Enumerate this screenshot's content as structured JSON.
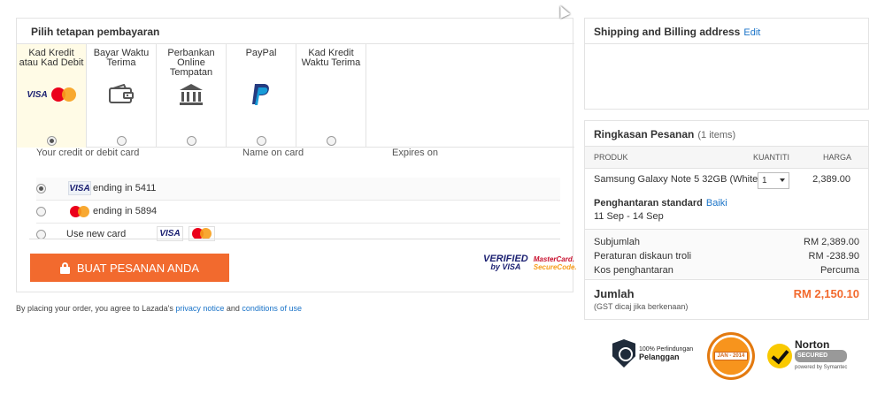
{
  "payment": {
    "title": "Pilih tetapan pembayaran",
    "tabs": [
      {
        "label": "Kad Kredit atau Kad Debit",
        "icon": "card-brands-icon",
        "selected": true
      },
      {
        "label": "Bayar Waktu Terima",
        "icon": "wallet-icon",
        "selected": false
      },
      {
        "label": "Perbankan Online Tempatan",
        "icon": "bank-icon",
        "selected": false
      },
      {
        "label": "PayPal",
        "icon": "paypal-icon",
        "selected": false
      },
      {
        "label": "Kad Kredit Waktu Terima",
        "icon": "",
        "selected": false
      }
    ],
    "card_table": {
      "headers": [
        "Your credit or debit card",
        "Name on card",
        "Expires on"
      ],
      "rows": [
        {
          "brand": "VISA",
          "text": "ending in 5411",
          "selected": true
        },
        {
          "brand": "MasterCard",
          "text": "ending in 5894",
          "selected": false
        },
        {
          "brand": "",
          "text": "Use new card",
          "selected": false
        }
      ]
    },
    "visa_text": "VISA",
    "place_order_label": "BUAT PESANAN ANDA",
    "verified_by_visa": {
      "line1": "VERIFIED",
      "line2": "by VISA"
    },
    "mc_securecode": {
      "line1": "MasterCard.",
      "line2": "SecureCode."
    },
    "terms": {
      "prefix": "By placing your order, you agree to Lazada's ",
      "privacy_link": "privacy notice",
      "and": " and ",
      "conditions_link": "conditions of use"
    }
  },
  "shipping": {
    "title": "Shipping and Billing address",
    "edit_label": "Edit"
  },
  "order": {
    "title": "Ringkasan Pesanan",
    "count": "(1 items)",
    "headers": {
      "product": "PRODUK",
      "qty": "KUANTITI",
      "price": "HARGA"
    },
    "product_name": "Samsung Galaxy Note 5 32GB (White)",
    "quantity": "1",
    "price": "2,389.00",
    "delivery": "Penghantaran standard",
    "delivery_change": "Baiki",
    "delivery_date": "11 Sep - 14 Sep",
    "summary": [
      {
        "label": "Subjumlah",
        "value": "RM 2,389.00"
      },
      {
        "label": "Peraturan diskaun troli",
        "value": "RM -238.90"
      },
      {
        "label": "Kos penghantaran",
        "value": "Percuma"
      }
    ],
    "total_label": "Jumlah",
    "total_value": "RM 2,150.10",
    "gst_note": "(GST dicaj jika berkenaan)"
  },
  "badges": {
    "protection": {
      "line1": "100% Perlindungan",
      "line2": "Pelanggan"
    },
    "pci": "JAN - 2014",
    "norton": {
      "name": "Norton",
      "secured": "SECURED",
      "by": "powered by Symantec"
    }
  },
  "colors": {
    "accent": "#f26a2e",
    "link": "#1a73c8"
  }
}
